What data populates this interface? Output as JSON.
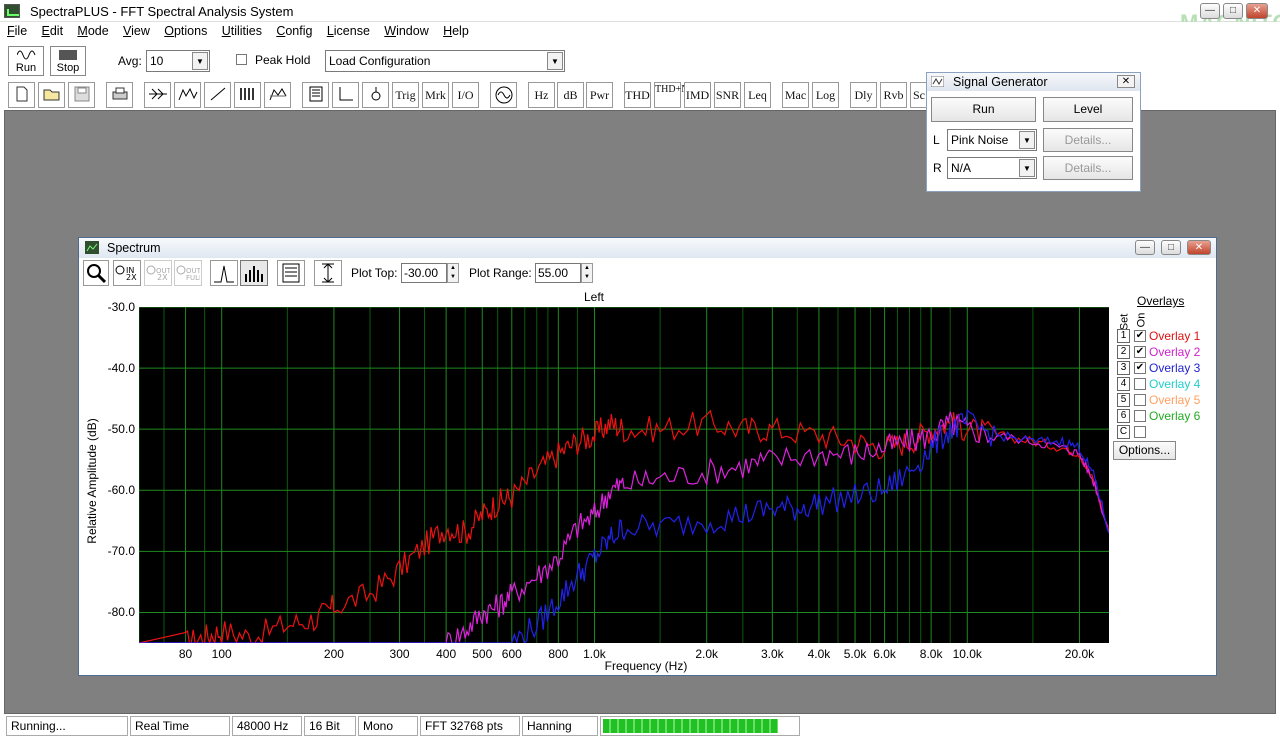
{
  "app": {
    "title": "SpectraPLUS - FFT Spectral Analysis System",
    "watermark": "MAGNITOLA"
  },
  "menu": [
    "File",
    "Edit",
    "Mode",
    "View",
    "Options",
    "Utilities",
    "Config",
    "License",
    "Window",
    "Help"
  ],
  "toolbar": {
    "run_label": "Run",
    "stop_label": "Stop",
    "avg_label": "Avg:",
    "avg_value": "10",
    "peak_hold_label": "Peak Hold",
    "config_value": "Load Configuration",
    "text_buttons": [
      "Trig",
      "Mrk",
      "I/O",
      "Hz",
      "dB",
      "Pwr",
      "THD",
      "THD+N",
      "IMD",
      "SNR",
      "Leq",
      "Mac",
      "Log",
      "Dly",
      "Rvb",
      "Sc"
    ]
  },
  "signal_generator": {
    "title": "Signal Generator",
    "run_label": "Run",
    "level_label": "Level",
    "left_label": "L",
    "right_label": "R",
    "left_value": "Pink Noise",
    "right_value": "N/A",
    "details_label": "Details..."
  },
  "spectrum": {
    "title": "Spectrum",
    "plot_top_label": "Plot Top:",
    "plot_top_value": "-30.00",
    "plot_range_label": "Plot Range:",
    "plot_range_value": "55.00",
    "channel_label": "Left",
    "overlays_label": "Overlays",
    "set_label": "Set",
    "on_label": "On",
    "options_label": "Options..."
  },
  "overlays": [
    {
      "num": "1",
      "name": "Overlay 1",
      "checked": true,
      "color": "#dd1111"
    },
    {
      "num": "2",
      "name": "Overlay 2",
      "checked": true,
      "color": "#cc22cc"
    },
    {
      "num": "3",
      "name": "Overlay 3",
      "checked": true,
      "color": "#2222cc"
    },
    {
      "num": "4",
      "name": "Overlay 4",
      "checked": false,
      "color": "#22cccc"
    },
    {
      "num": "5",
      "name": "Overlay 5",
      "checked": false,
      "color": "#ffa060"
    },
    {
      "num": "6",
      "name": "Overlay 6",
      "checked": false,
      "color": "#22aa22"
    },
    {
      "num": "C",
      "name": "",
      "checked": false,
      "color": "#000000"
    }
  ],
  "chart_data": {
    "type": "line",
    "title": "Left",
    "xlabel": "Frequency (Hz)",
    "ylabel": "Relative Amplitude (dB)",
    "xscale": "log",
    "xlim": [
      60,
      24000
    ],
    "ylim": [
      -85,
      -30
    ],
    "x_ticks": [
      "80",
      "100",
      "200",
      "300",
      "400",
      "500",
      "600",
      "800",
      "1.0k",
      "2.0k",
      "3.0k",
      "4.0k",
      "5.0k",
      "6.0k",
      "8.0k",
      "10.0k",
      "20.0k"
    ],
    "x_tick_values": [
      80,
      100,
      200,
      300,
      400,
      500,
      600,
      800,
      1000,
      2000,
      3000,
      4000,
      5000,
      6000,
      8000,
      10000,
      20000
    ],
    "y_ticks": [
      "-30.0",
      "-40.0",
      "-50.0",
      "-60.0",
      "-70.0",
      "-80.0"
    ],
    "y_tick_values": [
      -30,
      -40,
      -50,
      -60,
      -70,
      -80
    ],
    "grid": true,
    "series": [
      {
        "name": "Overlay 1",
        "color": "#ee1111",
        "x": [
          80,
          90,
          100,
          120,
          150,
          180,
          200,
          250,
          300,
          350,
          400,
          450,
          500,
          550,
          600,
          700,
          800,
          900,
          1000,
          1100,
          1200,
          1500,
          2000,
          2500,
          3000,
          4000,
          5000,
          6000,
          7000,
          8000,
          9000,
          10000,
          12000,
          15000,
          18000,
          20000,
          22000,
          24000
        ],
        "y": [
          -85,
          -84,
          -83,
          -84,
          -82,
          -81,
          -79,
          -77,
          -73,
          -69,
          -66,
          -67,
          -64,
          -62,
          -61,
          -57,
          -54,
          -52,
          -51,
          -49,
          -50,
          -50,
          -49,
          -50,
          -50,
          -51,
          -52,
          -53,
          -52,
          -50,
          -49,
          -50,
          -51,
          -52,
          -53,
          -54,
          -59,
          -67
        ]
      },
      {
        "name": "Overlay 2",
        "color": "#dd22dd",
        "x": [
          400,
          450,
          500,
          550,
          600,
          700,
          800,
          900,
          1000,
          1100,
          1200,
          1500,
          2000,
          2500,
          3000,
          4000,
          5000,
          6000,
          7000,
          8000,
          9000,
          10000,
          12000,
          15000,
          18000,
          20000,
          22000,
          24000
        ],
        "y": [
          -85,
          -83,
          -80,
          -79,
          -77,
          -74,
          -71,
          -66,
          -64,
          -60,
          -59,
          -58,
          -57,
          -56,
          -55,
          -54,
          -54,
          -53,
          -52,
          -51,
          -49,
          -50,
          -51,
          -52,
          -53,
          -54,
          -59,
          -67
        ]
      },
      {
        "name": "Overlay 3",
        "color": "#2222ee",
        "x": [
          600,
          700,
          800,
          900,
          1000,
          1100,
          1200,
          1500,
          2000,
          2500,
          3000,
          3500,
          4000,
          5000,
          6000,
          7000,
          8000,
          9000,
          10000,
          12000,
          15000,
          18000,
          20000,
          22000,
          24000
        ],
        "y": [
          -85,
          -82,
          -78,
          -74,
          -71,
          -68,
          -66,
          -66,
          -65,
          -64,
          -63,
          -63,
          -62,
          -61,
          -60,
          -57,
          -53,
          -50,
          -49,
          -51,
          -52,
          -52,
          -53,
          -58,
          -67
        ]
      }
    ]
  },
  "status": {
    "state": "Running...",
    "mode": "Real Time",
    "sample_rate": "48000 Hz",
    "bits": "16 Bit",
    "channels": "Mono",
    "fft": "FFT 32768 pts",
    "window": "Hanning",
    "progress": 0.9
  }
}
